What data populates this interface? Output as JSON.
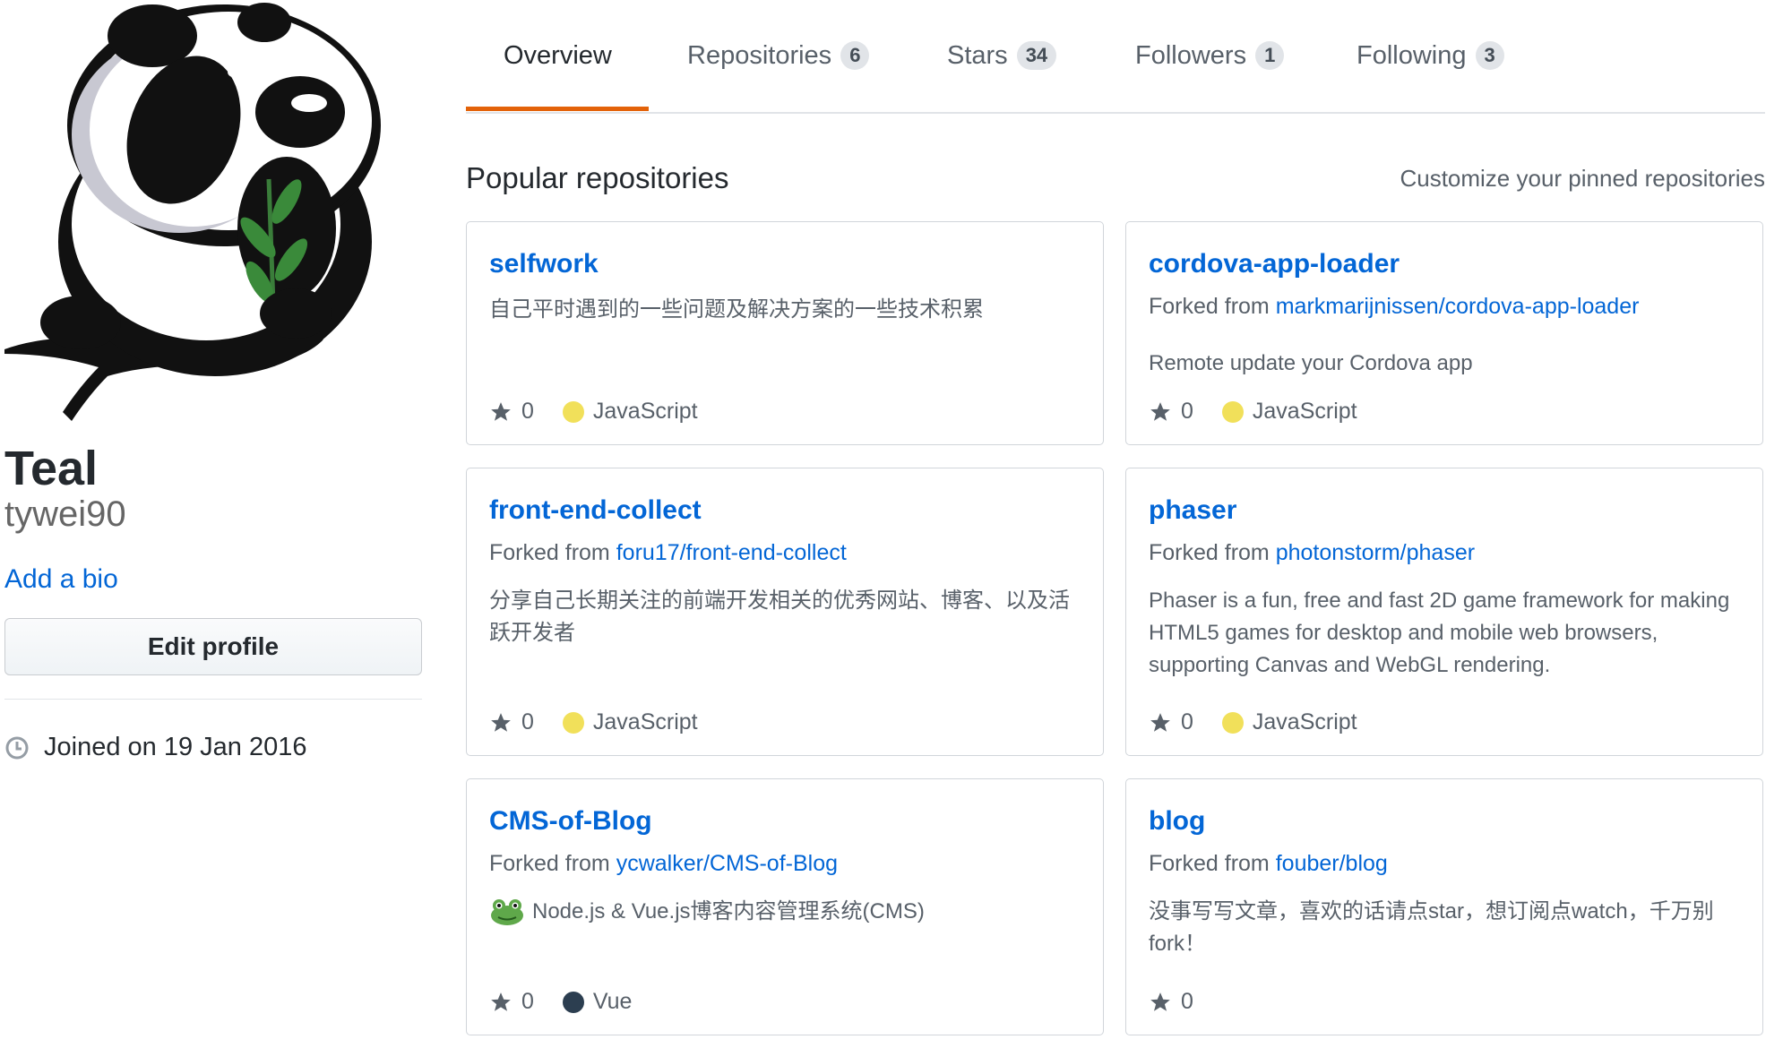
{
  "profile": {
    "fullname": "Teal",
    "username": "tywei90",
    "add_bio": "Add a bio",
    "edit_profile": "Edit profile",
    "joined": "Joined on 19 Jan 2016"
  },
  "tabs": [
    {
      "label": "Overview",
      "count": null,
      "active": true
    },
    {
      "label": "Repositories",
      "count": "6"
    },
    {
      "label": "Stars",
      "count": "34"
    },
    {
      "label": "Followers",
      "count": "1"
    },
    {
      "label": "Following",
      "count": "3"
    }
  ],
  "section": {
    "title": "Popular repositories",
    "customize": "Customize your pinned repositories"
  },
  "forked_prefix": "Forked from",
  "repos": [
    {
      "name": "selfwork",
      "forked_from": "",
      "description": "自己平时遇到的一些问题及解决方案的一些技术积累",
      "stars": "0",
      "language": "JavaScript",
      "language_color": "#f1e05a"
    },
    {
      "name": "cordova-app-loader",
      "forked_from": "markmarijnissen/cordova-app-loader",
      "description": "Remote update your Cordova app",
      "stars": "0",
      "language": "JavaScript",
      "language_color": "#f1e05a"
    },
    {
      "name": "front-end-collect",
      "forked_from": "foru17/front-end-collect",
      "description": "分享自己长期关注的前端开发相关的优秀网站、博客、以及活跃开发者",
      "stars": "0",
      "language": "JavaScript",
      "language_color": "#f1e05a"
    },
    {
      "name": "phaser",
      "forked_from": "photonstorm/phaser",
      "description": "Phaser is a fun, free and fast 2D game framework for making HTML5 games for desktop and mobile web browsers, supporting Canvas and WebGL rendering.",
      "stars": "0",
      "language": "JavaScript",
      "language_color": "#f1e05a"
    },
    {
      "name": "CMS-of-Blog",
      "forked_from": "ycwalker/CMS-of-Blog",
      "description": "Node.js & Vue.js博客内容管理系统(CMS)",
      "stars": "0",
      "language": "Vue",
      "language_color": "#2c3e50"
    },
    {
      "name": "blog",
      "forked_from": "fouber/blog",
      "description": "没事写写文章，喜欢的话请点star，想订阅点watch，千万别fork！",
      "stars": "0",
      "language": "",
      "language_color": ""
    }
  ]
}
